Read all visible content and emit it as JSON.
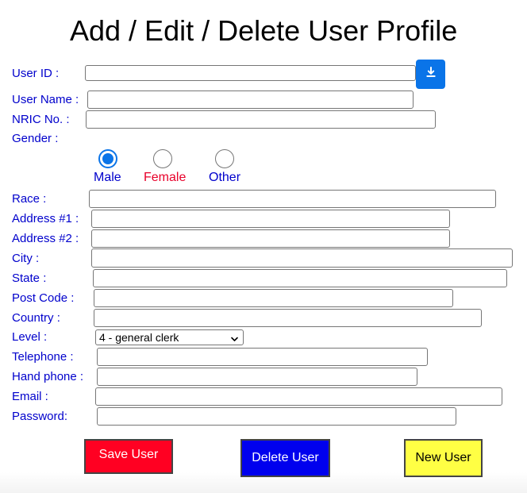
{
  "page": {
    "title": "Add / Edit / Delete User Profile"
  },
  "form": {
    "user_id": {
      "label": "User ID :",
      "value": ""
    },
    "user_name": {
      "label": "User Name :",
      "value": ""
    },
    "nric": {
      "label": "NRIC No. :",
      "value": ""
    },
    "gender": {
      "label": "Gender :",
      "options": [
        {
          "label": "Male",
          "color": "#0000cc",
          "checked": true
        },
        {
          "label": "Female",
          "color": "#e8002a",
          "checked": false
        },
        {
          "label": "Other",
          "color": "#0000cc",
          "checked": false
        }
      ]
    },
    "race": {
      "label": "Race :",
      "value": ""
    },
    "address1": {
      "label": "Address #1 :",
      "value": ""
    },
    "address2": {
      "label": "Address #2 :",
      "value": ""
    },
    "city": {
      "label": "City :",
      "value": ""
    },
    "state": {
      "label": "State :",
      "value": ""
    },
    "post_code": {
      "label": "Post Code :",
      "value": ""
    },
    "country": {
      "label": "Country :",
      "value": ""
    },
    "level": {
      "label": "Level :",
      "selected": "4 - general clerk"
    },
    "telephone": {
      "label": "Telephone :",
      "value": ""
    },
    "hand_phone": {
      "label": "Hand phone :",
      "value": ""
    },
    "email": {
      "label": "Email :",
      "value": ""
    },
    "password": {
      "label": "Password:",
      "value": ""
    }
  },
  "icons": {
    "lookup": "download-icon"
  },
  "buttons": {
    "save": {
      "label": "Save User",
      "bg": "#ff0022",
      "color": "#ffffff"
    },
    "delete": {
      "label": "Delete User",
      "bg": "#0000ee",
      "color": "#ffffff"
    },
    "new": {
      "label": "New User",
      "bg": "#ffff44",
      "color": "#000000"
    }
  },
  "colors": {
    "label_text": "#0000cc",
    "accent": "#0a74e8"
  }
}
